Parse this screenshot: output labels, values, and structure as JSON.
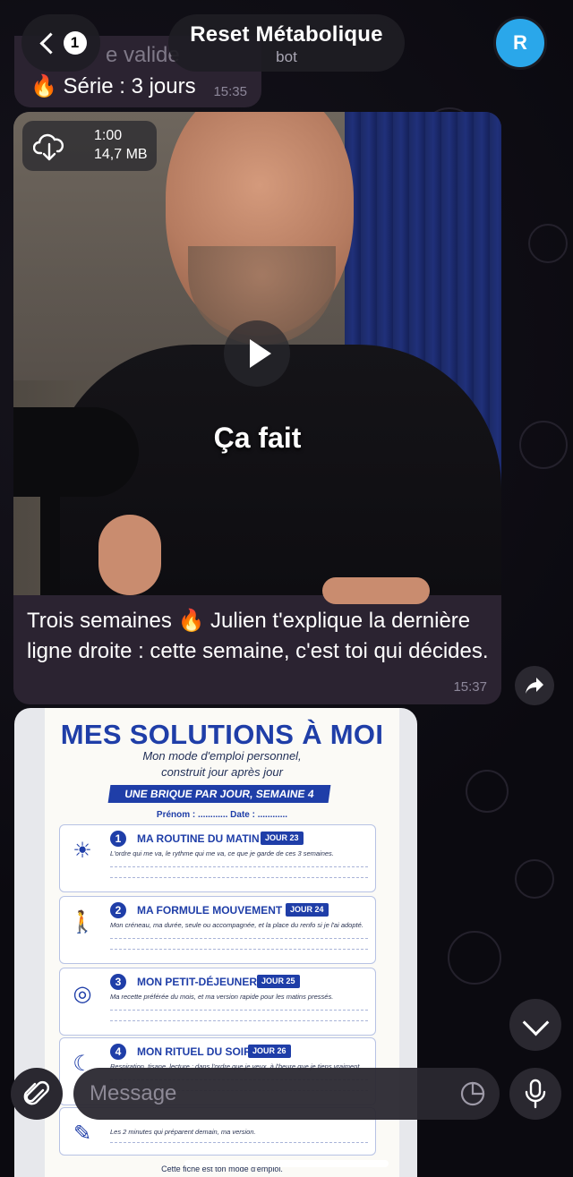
{
  "header": {
    "back_count": "1",
    "chat_title": "Reset Métabolique",
    "chat_subtitle": "bot",
    "avatar_letter": "R"
  },
  "previous_message": {
    "line1": "e valide",
    "line2": "🔥 Série : 3 jours",
    "time": "15:35"
  },
  "video_message": {
    "duration": "1:00",
    "size": "14,7 MB",
    "subtitle": "Ça fait",
    "caption": "Trois semaines 🔥 Julien t'explique la dernière ligne droite : cette semaine, c'est toi qui décides.",
    "time": "15:37"
  },
  "document": {
    "title": "MES SOLUTIONS À MOI",
    "subtitle1": "Mon mode d'emploi personnel,",
    "subtitle2": "construit jour après jour",
    "banner": "UNE BRIQUE PAR JOUR, SEMAINE 4",
    "fields": "Prénom : ............    Date : ............",
    "items": [
      {
        "num": "1",
        "icon": "sunrise-icon",
        "glyph": "☀",
        "title": "MA ROUTINE DU MATIN",
        "day": "JOUR 23",
        "desc": "L'ordre qui me va, le rythme qui me va, ce que je garde de ces 3 semaines."
      },
      {
        "num": "2",
        "icon": "walking-icon",
        "glyph": "🚶",
        "title": "MA FORMULE MOUVEMENT",
        "day": "JOUR 24",
        "desc": "Mon créneau, ma durée, seule ou accompagnée, et la place du renfo si je l'ai adopté."
      },
      {
        "num": "3",
        "icon": "egg-icon",
        "glyph": "◎",
        "title": "MON PETIT-DÉJEUNER",
        "day": "JOUR 25",
        "desc": "Ma recette préférée du mois, et ma version rapide pour les matins pressés."
      },
      {
        "num": "4",
        "icon": "moon-icon",
        "glyph": "☾",
        "title": "MON RITUEL DU SOIR",
        "day": "JOUR 26",
        "desc": "Respiration, tisane, lecture : dans l'ordre que je veux, à l'heure que je tiens vraiment."
      }
    ],
    "partial_item_desc": "Les 2 minutes qui préparent demain, ma version.",
    "footer": "Cette fiche est ton mode d'emploi."
  },
  "composer": {
    "placeholder": "Message"
  },
  "colors": {
    "bubble": "#2b2331",
    "accent_blue": "#1f3ea8",
    "avatar": "#2aa7ea"
  }
}
